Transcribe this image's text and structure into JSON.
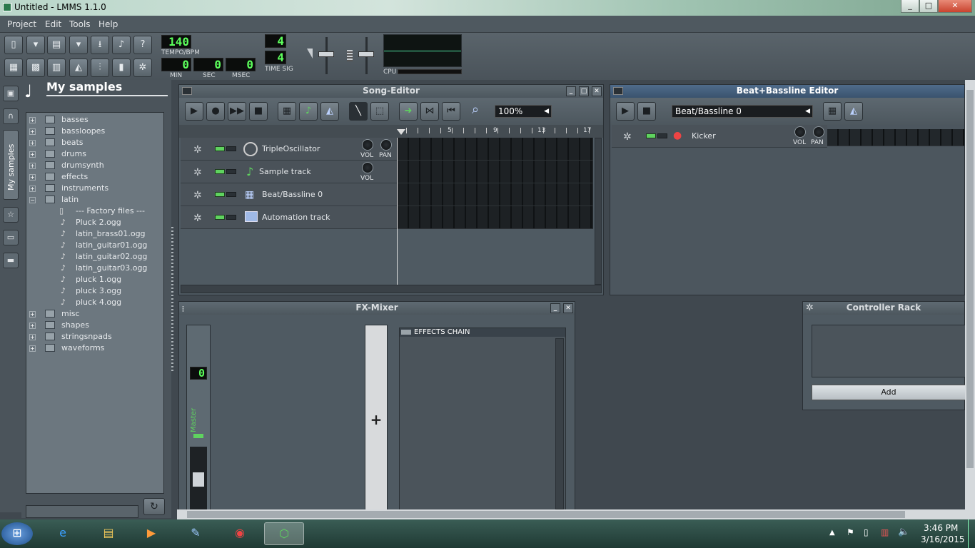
{
  "window": {
    "title": "Untitled - LMMS 1.1.0",
    "controls": {
      "minimize": "_",
      "maximize": "□",
      "close": "✕"
    }
  },
  "menu": [
    "Project",
    "Edit",
    "Tools",
    "Help"
  ],
  "toolbar": {
    "tempo": "140",
    "tempo_label": "TEMPO/BPM",
    "min": "0",
    "sec": "0",
    "msec": "0",
    "min_label": "MIN",
    "sec_label": "SEC",
    "msec_label": "MSEC",
    "timesig_num": "4",
    "timesig_den": "4",
    "timesig_label": "TIME SIG",
    "cpu_label": "CPU"
  },
  "sidebar": {
    "active_tab": "My samples",
    "title": "My samples",
    "tree": [
      {
        "label": "basses",
        "type": "folder",
        "expanded": false
      },
      {
        "label": "bassloopes",
        "type": "folder",
        "expanded": false
      },
      {
        "label": "beats",
        "type": "folder",
        "expanded": false
      },
      {
        "label": "drums",
        "type": "folder",
        "expanded": false
      },
      {
        "label": "drumsynth",
        "type": "folder",
        "expanded": false
      },
      {
        "label": "effects",
        "type": "folder",
        "expanded": false
      },
      {
        "label": "instruments",
        "type": "folder",
        "expanded": false
      },
      {
        "label": "latin",
        "type": "folder",
        "expanded": true
      },
      {
        "label": "--- Factory files ---",
        "type": "header"
      },
      {
        "label": "Pluck 2.ogg",
        "type": "file"
      },
      {
        "label": "latin_brass01.ogg",
        "type": "file"
      },
      {
        "label": "latin_guitar01.ogg",
        "type": "file"
      },
      {
        "label": "latin_guitar02.ogg",
        "type": "file"
      },
      {
        "label": "latin_guitar03.ogg",
        "type": "file"
      },
      {
        "label": "pluck 1.ogg",
        "type": "file"
      },
      {
        "label": "pluck 3.ogg",
        "type": "file"
      },
      {
        "label": "pluck 4.ogg",
        "type": "file"
      },
      {
        "label": "misc",
        "type": "folder",
        "expanded": false
      },
      {
        "label": "shapes",
        "type": "folder",
        "expanded": false
      },
      {
        "label": "stringsnpads",
        "type": "folder",
        "expanded": false
      },
      {
        "label": "waveforms",
        "type": "folder",
        "expanded": false
      }
    ]
  },
  "song_editor": {
    "title": "Song-Editor",
    "zoom": "100%",
    "timeline_marks": [
      "5",
      "9",
      "13",
      "17"
    ],
    "tracks": [
      {
        "name": "TripleOscillator",
        "knobs": [
          "VOL",
          "PAN"
        ]
      },
      {
        "name": "Sample track",
        "knobs": [
          "VOL"
        ]
      },
      {
        "name": "Beat/Bassline 0",
        "knobs": []
      },
      {
        "name": "Automation track",
        "knobs": []
      }
    ]
  },
  "bb_editor": {
    "title": "Beat+Bassline Editor",
    "selected": "Beat/Bassline 0",
    "tracks": [
      {
        "name": "Kicker",
        "knobs": [
          "VOL",
          "PAN"
        ]
      }
    ]
  },
  "fx_mixer": {
    "title": "FX-Mixer",
    "channel_number": "0",
    "master_label": "Master",
    "add_glyph": "+",
    "effects_chain_label": "EFFECTS CHAIN"
  },
  "controller_rack": {
    "title": "Controller Rack",
    "add_label": "Add"
  },
  "taskbar": {
    "time": "3:46 PM",
    "date": "3/16/2015"
  },
  "colors": {
    "lcd_green": "#5cff5c",
    "active_title": "#3a536e",
    "led_on": "#5fd35f"
  }
}
